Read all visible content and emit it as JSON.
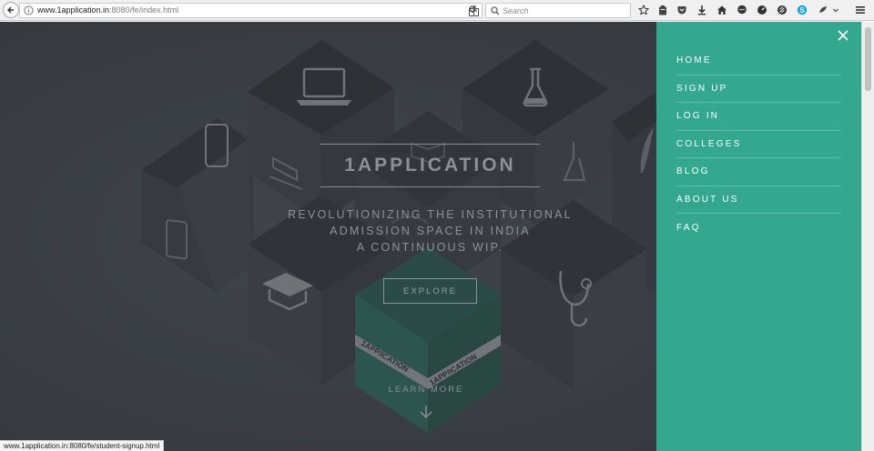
{
  "browser": {
    "url_host": "www.1application.in",
    "url_rest": ":8080/fe/index.html",
    "search_placeholder": "Search",
    "toolbar_icons": [
      "star-icon",
      "clipboard-icon",
      "pocket-icon",
      "download-icon",
      "home-icon",
      "chat-icon",
      "speedometer-icon",
      "extension-icon",
      "skype-icon",
      "extension-two-icon",
      "overflow-icon",
      "menu-icon"
    ]
  },
  "hero": {
    "title": "1APPLICATION",
    "tagline_lines": [
      "REVOLUTIONIZING THE INSTITUTIONAL",
      "ADMISSION SPACE IN INDIA",
      "A CONTINUOUS WIP."
    ],
    "explore_label": "EXPLORE",
    "learn_more_label": "LEARN MORE",
    "banner_text": "1APP",
    "banner_text_two": "ICATION"
  },
  "menu": {
    "items": [
      {
        "label": "HOME"
      },
      {
        "label": "SIGN UP"
      },
      {
        "label": "LOG IN"
      },
      {
        "label": "COLLEGES"
      },
      {
        "label": "BLOG"
      },
      {
        "label": "ABOUT US"
      },
      {
        "label": "FAQ"
      }
    ]
  },
  "status_bar": {
    "text": "www.1application.in:8080/fe/student-signup.html"
  },
  "colors": {
    "menu_bg": "#33a88f",
    "hero_bg": "#3d4249",
    "accent_cube": "#2c5d55"
  }
}
